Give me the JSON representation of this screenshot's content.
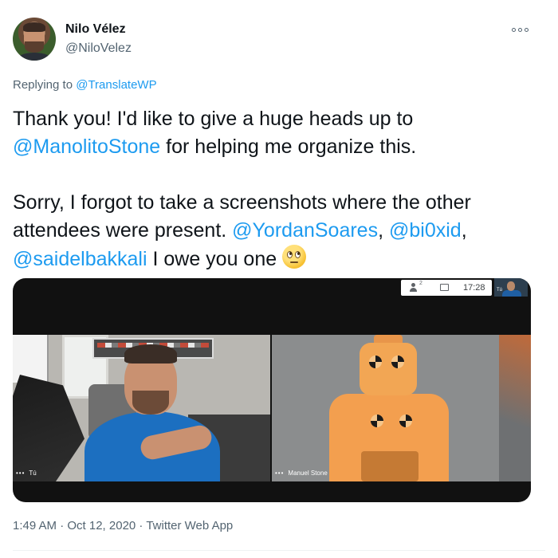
{
  "author": {
    "name": "Nilo Vélez",
    "handle": "@NiloVelez"
  },
  "reply": {
    "prefix": "Replying to",
    "to": "@TranslateWP"
  },
  "tweet": {
    "line1_text": "Thank you! I'd like to give a huge heads up to",
    "mention_manolito": "@ManolitoStone",
    "line2_text": " for helping me organize this.",
    "line3_text": "Sorry, I forgot to take a screenshots where the other attendees were present. ",
    "mention_yordan": "@YordanSoares",
    "comma1": ", ",
    "mention_bi0xid": "@bi0xid",
    "comma2": ",",
    "mention_saidel": "@saidelbakkali",
    "line4_text": " I owe you one ",
    "emoji": "face-with-rolling-eyes"
  },
  "meet_ui": {
    "people_count": "2",
    "time": "17:28",
    "self_label": "Tú"
  },
  "tiles": {
    "left_label": "Tú",
    "right_label": "Manuel Stone",
    "dots": "•••"
  },
  "meta": {
    "timestamp": "1:49 AM · Oct 12, 2020 · Twitter Web App"
  },
  "colors": {
    "link": "#1d9bf0",
    "secondary_text": "#536471",
    "primary_text": "#0f1419"
  }
}
